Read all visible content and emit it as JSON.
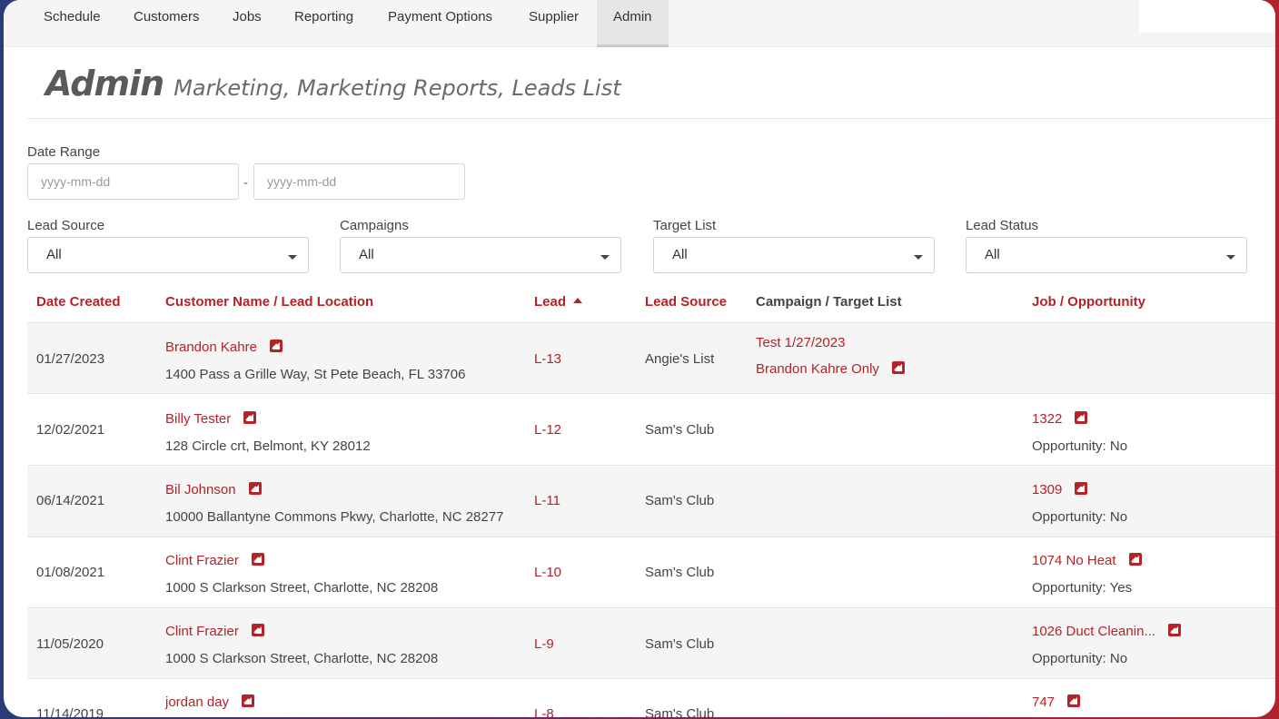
{
  "nav": {
    "items": [
      "Schedule",
      "Customers",
      "Jobs",
      "Reporting",
      "Payment Options",
      "Supplier",
      "Admin"
    ],
    "active": "Admin"
  },
  "title": {
    "main": "Admin",
    "sub": "Marketing, Marketing Reports, Leads List"
  },
  "filters": {
    "date_range_label": "Date Range",
    "date_from_placeholder": "yyyy-mm-dd",
    "date_to_placeholder": "yyyy-mm-dd",
    "date_separator": "-",
    "lead_source": {
      "label": "Lead Source",
      "value": "All"
    },
    "campaigns": {
      "label": "Campaigns",
      "value": "All"
    },
    "target_list": {
      "label": "Target List",
      "value": "All"
    },
    "lead_status": {
      "label": "Lead Status",
      "value": "All"
    }
  },
  "table": {
    "headers": {
      "date_created": "Date Created",
      "customer": "Customer Name / Lead Location",
      "lead": "Lead",
      "lead_source": "Lead Source",
      "campaign": "Campaign / Target List",
      "job": "Job / Opportunity"
    },
    "rows": [
      {
        "date": "01/27/2023",
        "name": "Brandon Kahre",
        "address": "1400 Pass a Grille Way, St Pete Beach, FL 33706",
        "lead": "L-13",
        "source": "Angie's List",
        "campaign": "Test 1/27/2023",
        "target": "Brandon Kahre Only",
        "job": "",
        "opportunity": ""
      },
      {
        "date": "12/02/2021",
        "name": "Billy Tester",
        "address": "128 Circle crt, Belmont, KY 28012",
        "lead": "L-12",
        "source": "Sam's Club",
        "campaign": "",
        "target": "",
        "job": "1322",
        "opportunity": "Opportunity: No"
      },
      {
        "date": "06/14/2021",
        "name": "Bil Johnson",
        "address": "10000 Ballantyne Commons Pkwy, Charlotte, NC 28277",
        "lead": "L-11",
        "source": "Sam's Club",
        "campaign": "",
        "target": "",
        "job": "1309",
        "opportunity": "Opportunity: No"
      },
      {
        "date": "01/08/2021",
        "name": "Clint Frazier",
        "address": "1000 S Clarkson Street, Charlotte, NC 28208",
        "lead": "L-10",
        "source": "Sam's Club",
        "campaign": "",
        "target": "",
        "job": "1074 No Heat",
        "opportunity": "Opportunity: Yes"
      },
      {
        "date": "11/05/2020",
        "name": "Clint Frazier",
        "address": "1000 S Clarkson Street, Charlotte, NC 28208",
        "lead": "L-9",
        "source": "Sam's Club",
        "campaign": "",
        "target": "",
        "job": "1026 Duct Cleanin...",
        "opportunity": "Opportunity: No"
      },
      {
        "date": "11/14/2019",
        "name": "jordan day",
        "address": "",
        "lead": "L-8",
        "source": "Sam's Club",
        "campaign": "",
        "target": "",
        "job": "747",
        "opportunity": ""
      }
    ]
  }
}
